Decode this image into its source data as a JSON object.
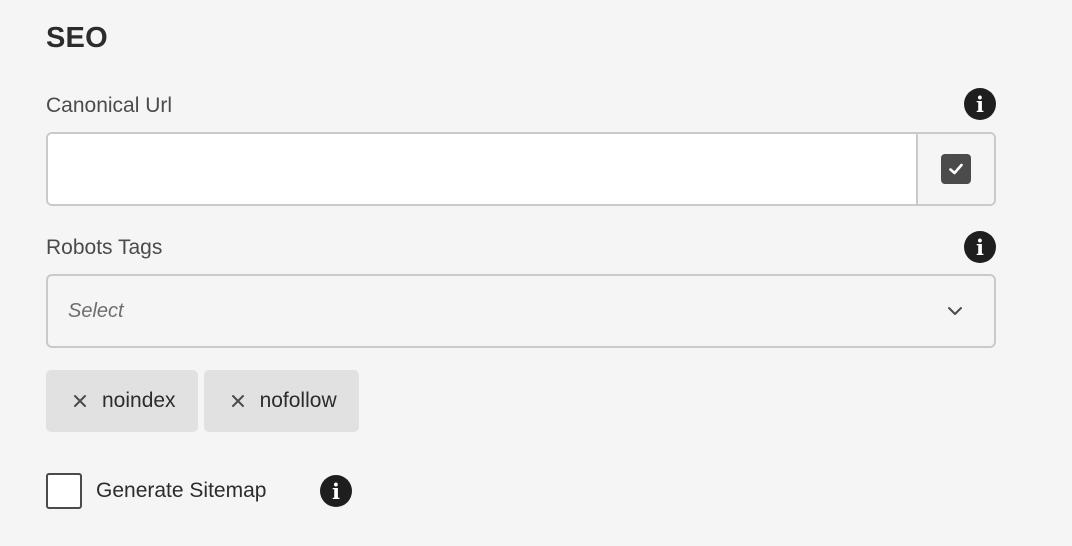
{
  "section": {
    "title": "SEO"
  },
  "canonical": {
    "label": "Canonical Url",
    "value": "",
    "placeholder": "",
    "info_icon": "info-icon",
    "validate_icon": "checkbox-checked-icon"
  },
  "robots": {
    "label": "Robots Tags",
    "placeholder": "Select",
    "info_icon": "info-icon",
    "dropdown_icon": "chevron-down-icon",
    "tags": [
      {
        "label": "noindex",
        "remove_icon": "close-icon"
      },
      {
        "label": "nofollow",
        "remove_icon": "close-icon"
      }
    ]
  },
  "sitemap": {
    "label": "Generate Sitemap",
    "checked": false,
    "info_icon": "info-icon"
  },
  "colors": {
    "background": "#f5f5f5",
    "border": "#cacaca",
    "tag_background": "#e1e1e1",
    "icon_dark": "#1e1e1e",
    "text": "#4b4b4b"
  }
}
